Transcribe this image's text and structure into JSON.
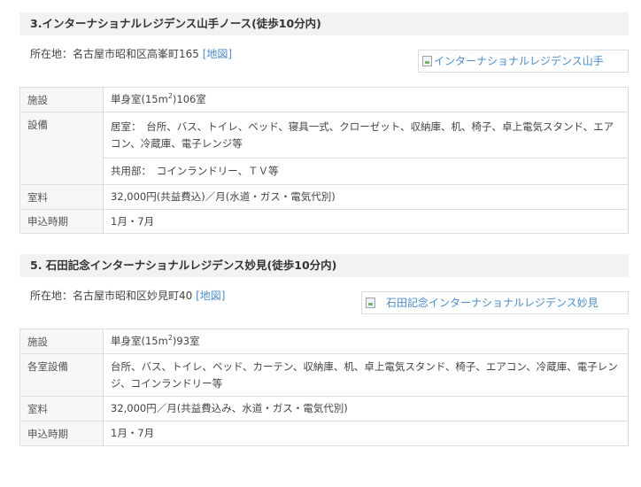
{
  "section1": {
    "title": "3.インターナショナルレジデンス山手ノース(徒歩10分内)",
    "address_label": "所在地：名古屋市昭和区高峯町165",
    "map_link": "[地図]",
    "image_alt": "インターナショナルレジデンス山手",
    "rows": {
      "facility": {
        "label": "施設",
        "value_prefix": "単身室(15m",
        "value_sup": "2",
        "value_suffix": ")106室"
      },
      "equipment": {
        "label": "設備",
        "room": "居室：　台所、バス、トイレ、ベッド、寝具一式、クローゼット、収納庫、机、椅子、卓上電気スタンド、エアコン、冷蔵庫、電子レンジ等",
        "common": "共用部：　コインランドリー、ＴＶ等"
      },
      "rent": {
        "label": "室料",
        "value": "32,000円(共益費込)／月(水道・ガス・電気代別)"
      },
      "application": {
        "label": "申込時期",
        "value": "1月・7月"
      }
    }
  },
  "section2": {
    "title": "5. 石田記念インターナショナルレジデンス妙見(徒歩10分内)",
    "address_label": "所在地：名古屋市昭和区妙見町40",
    "map_link": "[地図]",
    "image_alt": "石田記念インターナショナルレジデンス妙見",
    "rows": {
      "facility": {
        "label": "施設",
        "value_prefix": "単身室(15m",
        "value_sup": "2",
        "value_suffix": ")93室"
      },
      "equipment": {
        "label": "各室設備",
        "value": "台所、バス、トイレ、ベッド、カーテン、収納庫、机、卓上電気スタンド、椅子、エアコン、冷蔵庫、電子レンジ、コインランドリー等"
      },
      "rent": {
        "label": "室料",
        "value": "32,000円／月(共益費込み、水道・ガス・電気代別)"
      },
      "application": {
        "label": "申込時期",
        "value": "1月・7月"
      }
    }
  }
}
